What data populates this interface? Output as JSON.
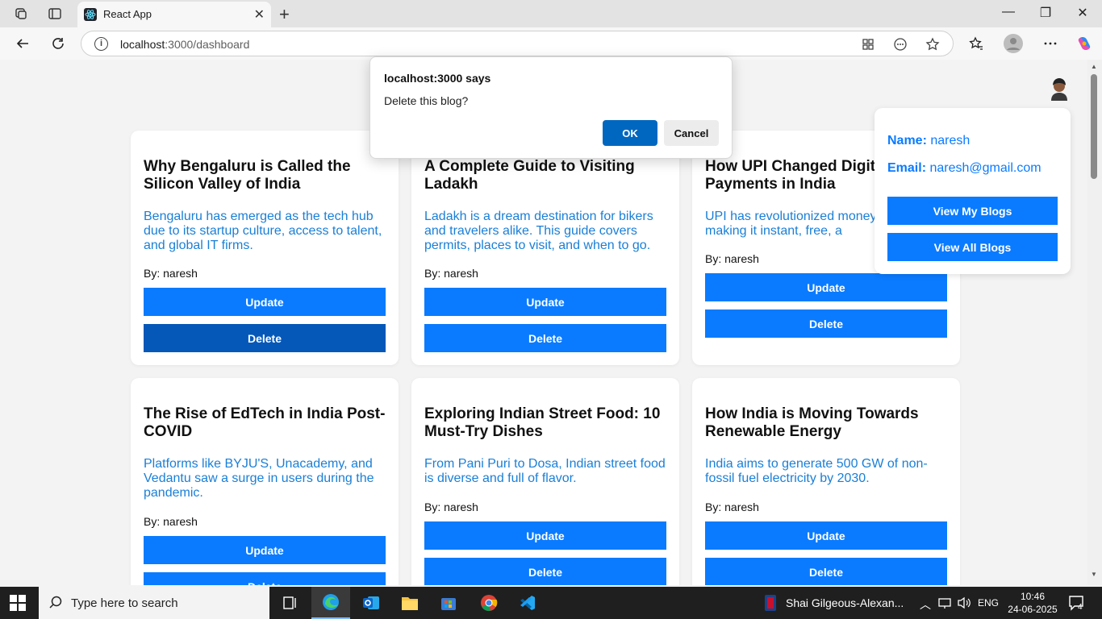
{
  "browser": {
    "tab_title": "React App",
    "url_host": "localhost",
    "url_path": ":3000/dashboard"
  },
  "dialog": {
    "title": "localhost:3000 says",
    "message": "Delete this blog?",
    "ok_label": "OK",
    "cancel_label": "Cancel"
  },
  "profile": {
    "name_label": "Name:",
    "name_value": "naresh",
    "email_label": "Email:",
    "email_value": "naresh@gmail.com",
    "view_my_blogs": "View My Blogs",
    "view_all_blogs": "View All Blogs"
  },
  "cards": [
    {
      "title": "Why Bengaluru is Called the Silicon Valley of India",
      "desc": "Bengaluru has emerged as the tech hub due to its startup culture, access to talent, and global IT firms.",
      "author": "By: naresh",
      "update": "Update",
      "delete": "Delete"
    },
    {
      "title": "A Complete Guide to Visiting Ladakh",
      "desc": "Ladakh is a dream destination for bikers and travelers alike. This guide covers permits, places to visit, and when to go.",
      "author": "By: naresh",
      "update": "Update",
      "delete": "Delete"
    },
    {
      "title": "How UPI Changed Digita Payments in India",
      "desc": "UPI has revolutionized money India, making it instant, free, a",
      "author": "By: naresh",
      "update": "Update",
      "delete": "Delete"
    },
    {
      "title": "The Rise of EdTech in India Post-COVID",
      "desc": "Platforms like BYJU'S, Unacademy, and Vedantu saw a surge in users during the pandemic.",
      "author": "By: naresh",
      "update": "Update",
      "delete": "Delete"
    },
    {
      "title": "Exploring Indian Street Food: 10 Must-Try Dishes",
      "desc": "From Pani Puri to Dosa, Indian street food is diverse and full of flavor.",
      "author": "By: naresh",
      "update": "Update",
      "delete": "Delete"
    },
    {
      "title": "How India is Moving Towards Renewable Energy",
      "desc": "India aims to generate 500 GW of non-fossil fuel electricity by 2030.",
      "author": "By: naresh",
      "update": "Update",
      "delete": "Delete"
    }
  ],
  "taskbar": {
    "search_placeholder": "Type here to search",
    "news": "Shai Gilgeous-Alexan...",
    "language": "ENG",
    "time": "10:46",
    "date": "24-06-2025",
    "notifications": "4"
  },
  "colors": {
    "accent": "#0a7bff",
    "link_text": "#1a7fd6",
    "dialog_ok": "#0067c0"
  }
}
